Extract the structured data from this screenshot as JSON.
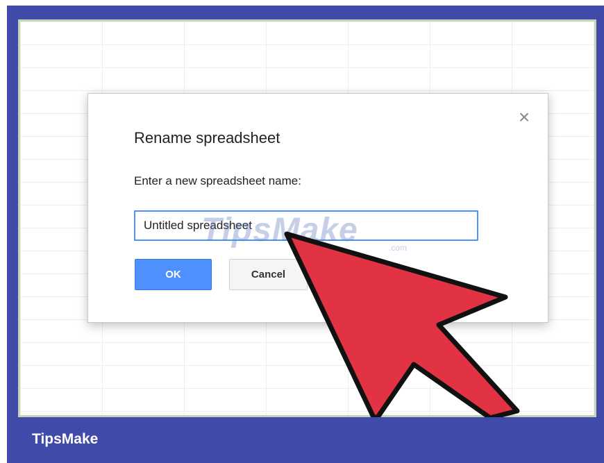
{
  "dialog": {
    "title": "Rename spreadsheet",
    "prompt": "Enter a new spreadsheet name:",
    "input_value": "Untitled spreadsheet",
    "ok_label": "OK",
    "cancel_label": "Cancel",
    "close_glyph": "×"
  },
  "watermark": {
    "text": "TipsMake",
    "suffix": ".com"
  },
  "footer": {
    "brand": "TipsMake"
  },
  "colors": {
    "frame": "#3f4aa9",
    "accent": "#4d90fe",
    "arrow_fill": "#e13344",
    "arrow_stroke": "#111111"
  },
  "icons": {
    "close": "close-icon",
    "pointer": "cursor-arrow-icon"
  }
}
